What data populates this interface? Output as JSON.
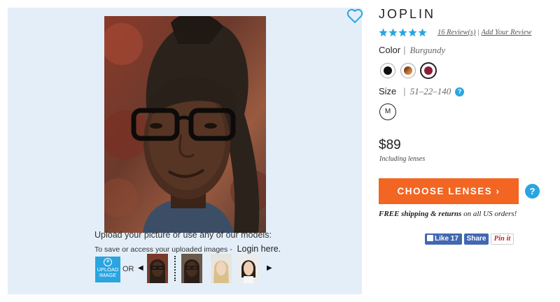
{
  "tryon": {
    "upload_prompt": "Upload your picture or use any of our models:",
    "save_prompt": "To save or access your uploaded images -",
    "login_link": "Login here.",
    "upload_button_line1": "UPLOAD",
    "upload_button_line2": "IMAGE",
    "or_label": "OR",
    "prev_arrow": "◀",
    "next_arrow": "▶"
  },
  "product": {
    "name": "JOPLIN",
    "rating_stars": 5,
    "reviews_link": "16 Review(s)",
    "reviews_separator": "|",
    "add_review_link": "Add Your Review",
    "color_label": "Color",
    "color_separator": "|",
    "color_value": "Burgundy",
    "swatches": [
      {
        "name": "black",
        "color": "#111111"
      },
      {
        "name": "tortoise",
        "color": "#b5652a"
      },
      {
        "name": "burgundy",
        "color": "#8a1e3a"
      }
    ],
    "size_label": "Size",
    "size_separator": "|",
    "size_value": "51–22–140",
    "size_help": "?",
    "size_option": "M",
    "price": "$89",
    "price_note": "Including lenses",
    "cta_label": "CHOOSE LENSES ›",
    "cta_help": "?",
    "shipping_bold": "FREE shipping & returns",
    "shipping_rest": " on all US orders!"
  },
  "social": {
    "like_label": "Like 17",
    "share_label": "Share",
    "pin_label": "Pin it"
  },
  "colors": {
    "accent_blue": "#2aa5e0",
    "cta_orange": "#f26522",
    "panel_bg": "#e3eef8",
    "facebook": "#4267b2"
  }
}
